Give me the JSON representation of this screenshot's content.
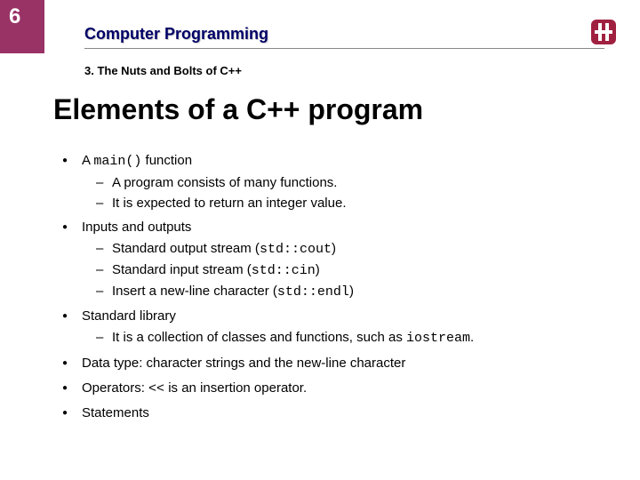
{
  "page_number": "6",
  "course_title": "Computer Programming",
  "chapter": "3. The Nuts and Bolts of C++",
  "slide_title": "Elements of a C++ program",
  "bullets": {
    "b0": {
      "pre": "A ",
      "code": "main()",
      "post": " function"
    },
    "b0s0": "A program consists of many functions.",
    "b0s1": "It is expected to return an integer value.",
    "b1": "Inputs and outputs",
    "b1s0": {
      "pre": "Standard output stream (",
      "code": "std::cout",
      "post": ")"
    },
    "b1s1": {
      "pre": "Standard input stream (",
      "code": "std::cin",
      "post": ")"
    },
    "b1s2": {
      "pre": "Insert a new-line character (",
      "code": "std::endl",
      "post": ")"
    },
    "b2": "Standard library",
    "b2s0": {
      "pre": "It is a collection of classes and functions, such as ",
      "code": "iostream",
      "post": "."
    },
    "b3": "Data type: character strings and the new-line character",
    "b4": {
      "pre": "Operators: ",
      "code": "<<",
      "post": " is an insertion operator."
    },
    "b5": "Statements"
  }
}
